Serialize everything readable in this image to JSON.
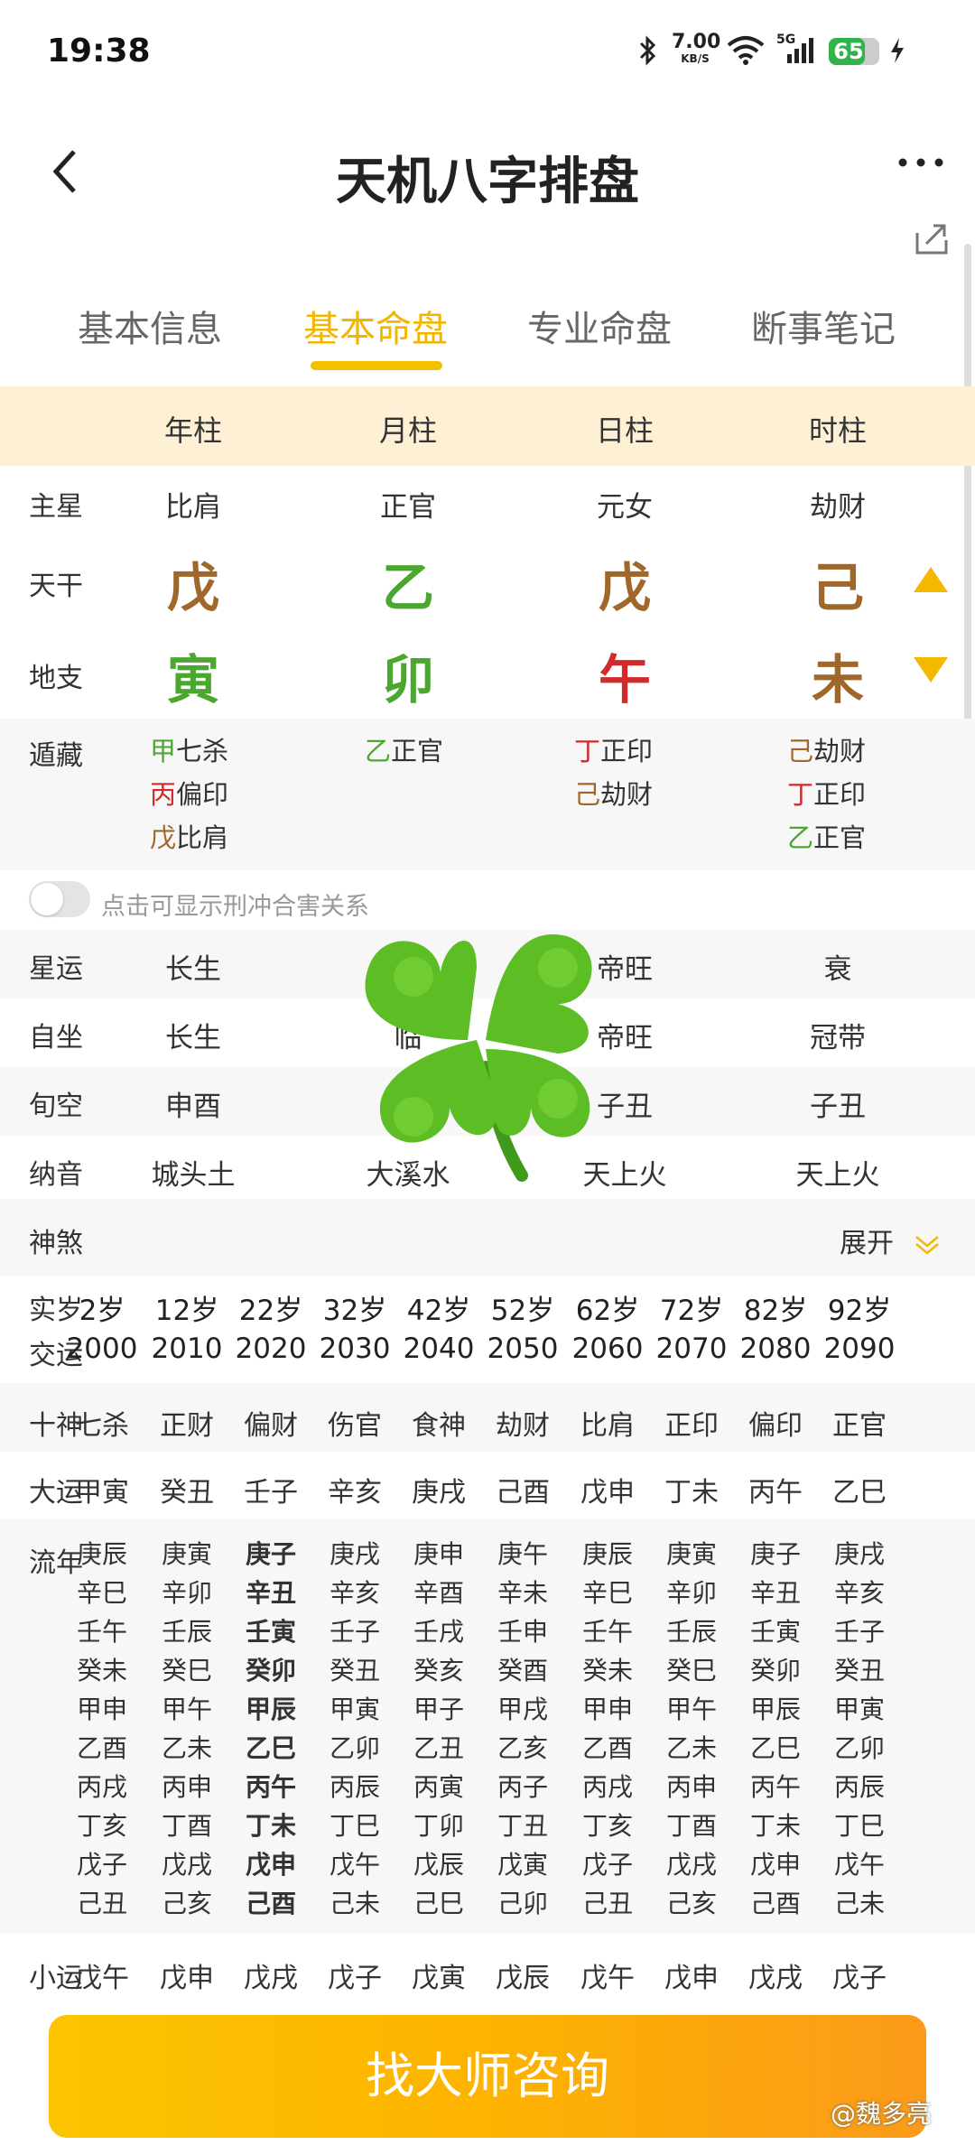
{
  "status": {
    "time": "19:38",
    "speed_value": "7.00",
    "speed_unit": "KB/S",
    "network": "5G",
    "battery": "65"
  },
  "nav": {
    "back_icon": "chevron-left-icon",
    "title": "天机八字排盘",
    "more_icon": "more-horizontal-icon"
  },
  "tabs": [
    "基本信息",
    "基本命盘",
    "专业命盘",
    "断事笔记"
  ],
  "active_tab": 1,
  "columns": [
    "年柱",
    "月柱",
    "日柱",
    "时柱"
  ],
  "rows": {
    "zhuxing": {
      "label": "主星",
      "values": [
        "比肩",
        "正官",
        "元女",
        "劫财"
      ]
    },
    "tiangan": {
      "label": "天干",
      "values": [
        "戊",
        "乙",
        "戊",
        "己"
      ],
      "colors": [
        "#a0672a",
        "#4aa82e",
        "#a0672a",
        "#a0672a"
      ]
    },
    "dizhi": {
      "label": "地支",
      "values": [
        "寅",
        "卯",
        "午",
        "未"
      ],
      "colors": [
        "#4aa82e",
        "#4aa82e",
        "#d12a2a",
        "#a0672a"
      ]
    },
    "canggan": {
      "label": "遁藏",
      "cols": [
        [
          {
            "g": "甲",
            "t": "七杀",
            "c": "#4aa82e"
          },
          {
            "g": "丙",
            "t": "偏印",
            "c": "#d12a2a"
          },
          {
            "g": "戊",
            "t": "比肩",
            "c": "#a0672a"
          }
        ],
        [
          {
            "g": "乙",
            "t": "正官",
            "c": "#4aa82e"
          }
        ],
        [
          {
            "g": "丁",
            "t": "正印",
            "c": "#d12a2a"
          },
          {
            "g": "己",
            "t": "劫财",
            "c": "#a0672a"
          }
        ],
        [
          {
            "g": "己",
            "t": "劫财",
            "c": "#a0672a"
          },
          {
            "g": "丁",
            "t": "正印",
            "c": "#d12a2a"
          },
          {
            "g": "乙",
            "t": "正官",
            "c": "#4aa82e"
          }
        ]
      ]
    },
    "xingyun": {
      "label": "星运",
      "values": [
        "长生",
        "",
        "帝旺",
        "衰"
      ]
    },
    "zizuo": {
      "label": "自坐",
      "values": [
        "长生",
        "临",
        "帝旺",
        "冠带"
      ]
    },
    "xunkong": {
      "label": "旬空",
      "values": [
        "申酉",
        "",
        "子丑",
        "子丑"
      ]
    },
    "nayin": {
      "label": "纳音",
      "values": [
        "城头土",
        "大溪水",
        "天上火",
        "天上火"
      ]
    }
  },
  "toggle": {
    "label": "点击可显示刑冲合害关系"
  },
  "shensha": {
    "label": "神煞",
    "expand": "展开"
  },
  "dayun": {
    "age_label": "实岁",
    "ages": [
      "2岁",
      "12岁",
      "22岁",
      "32岁",
      "42岁",
      "52岁",
      "62岁",
      "72岁",
      "82岁",
      "92岁"
    ],
    "year_label": "交运",
    "years": [
      "2000",
      "2010",
      "2020",
      "2030",
      "2040",
      "2050",
      "2060",
      "2070",
      "2080",
      "2090"
    ],
    "shishen_label": "十神",
    "shishen": [
      "七杀",
      "正财",
      "偏财",
      "伤官",
      "食神",
      "劫财",
      "比肩",
      "正印",
      "偏印",
      "正官"
    ],
    "dayun_label": "大运",
    "dayun": [
      "甲寅",
      "癸丑",
      "壬子",
      "辛亥",
      "庚戌",
      "己酉",
      "戊申",
      "丁未",
      "丙午",
      "乙巳"
    ],
    "liunian_label": "流年",
    "liunian": [
      [
        "庚辰",
        "辛巳",
        "壬午",
        "癸未",
        "甲申",
        "乙酉",
        "丙戌",
        "丁亥",
        "戊子",
        "己丑"
      ],
      [
        "庚寅",
        "辛卯",
        "壬辰",
        "癸巳",
        "甲午",
        "乙未",
        "丙申",
        "丁酉",
        "戊戌",
        "己亥"
      ],
      [
        "庚子",
        "辛丑",
        "壬寅",
        "癸卯",
        "甲辰",
        "乙巳",
        "丙午",
        "丁未",
        "戊申",
        "己酉"
      ],
      [
        "庚戌",
        "辛亥",
        "壬子",
        "癸丑",
        "甲寅",
        "乙卯",
        "丙辰",
        "丁巳",
        "戊午",
        "己未"
      ],
      [
        "庚申",
        "辛酉",
        "壬戌",
        "癸亥",
        "甲子",
        "乙丑",
        "丙寅",
        "丁卯",
        "戊辰",
        "己巳"
      ],
      [
        "庚午",
        "辛未",
        "壬申",
        "癸酉",
        "甲戌",
        "乙亥",
        "丙子",
        "丁丑",
        "戊寅",
        "己卯"
      ],
      [
        "庚辰",
        "辛巳",
        "壬午",
        "癸未",
        "甲申",
        "乙酉",
        "丙戌",
        "丁亥",
        "戊子",
        "己丑"
      ],
      [
        "庚寅",
        "辛卯",
        "壬辰",
        "癸巳",
        "甲午",
        "乙未",
        "丙申",
        "丁酉",
        "戊戌",
        "己亥"
      ],
      [
        "庚子",
        "辛丑",
        "壬寅",
        "癸卯",
        "甲辰",
        "乙巳",
        "丙午",
        "丁未",
        "戊申",
        "己酉"
      ],
      [
        "庚戌",
        "辛亥",
        "壬子",
        "癸丑",
        "甲寅",
        "乙卯",
        "丙辰",
        "丁巳",
        "戊午",
        "己未"
      ]
    ],
    "xiaoyun_label": "小运",
    "xiaoyun": [
      "戊午",
      "戊申",
      "戊戌",
      "戊子",
      "戊寅",
      "戊辰",
      "戊午",
      "戊申",
      "戊戌",
      "戊子"
    ]
  },
  "cta": {
    "label": "找大师咨询"
  },
  "watermark": "@魏多亮"
}
